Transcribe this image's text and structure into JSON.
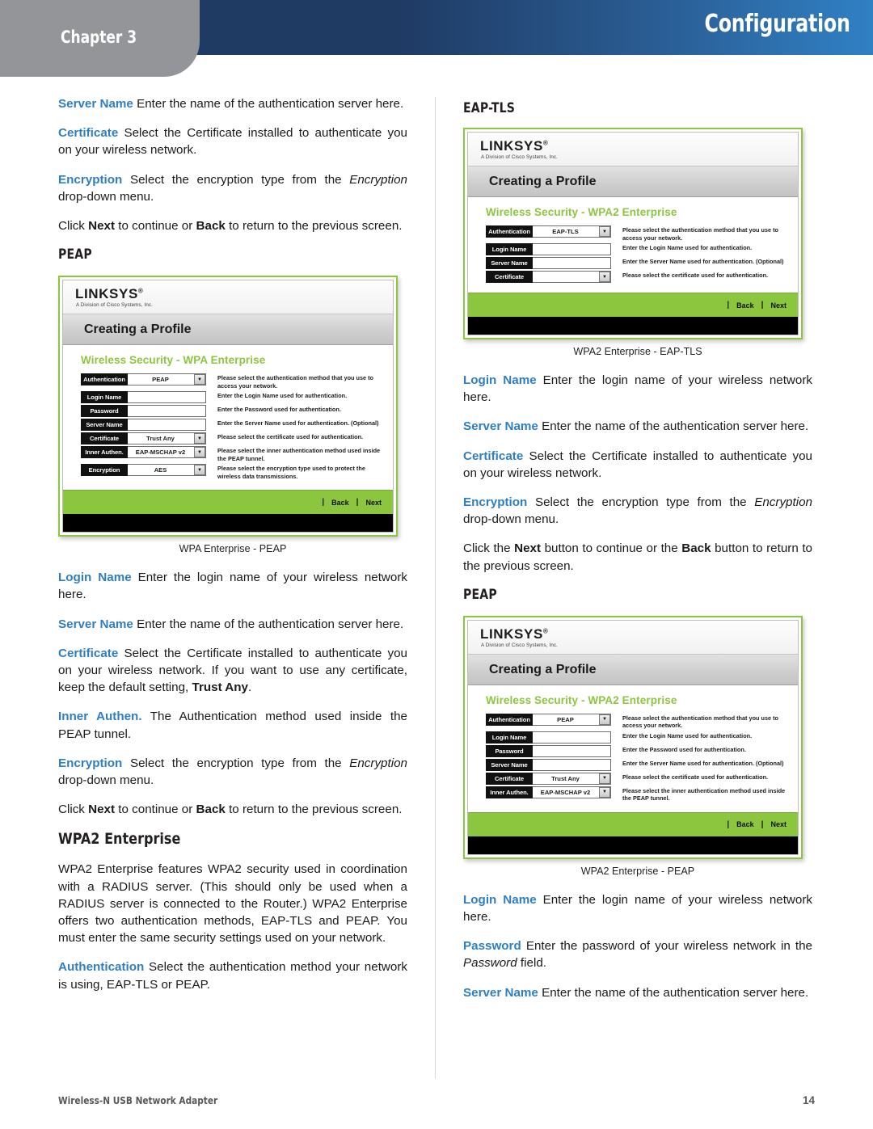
{
  "header": {
    "chapter": "Chapter 3",
    "title": "Configuration"
  },
  "footer": {
    "product": "Wireless-N USB Network Adapter",
    "page_number": "14"
  },
  "colors": {
    "accent_blue": "#2e7ec4",
    "header_navy": "#1f3a63",
    "header_blue": "#3080c4",
    "chapter_gray": "#939598",
    "linksys_green": "#8cc63e"
  },
  "left_column": {
    "para_server_name": {
      "term": "Server Name",
      "text": " Enter the name of the authentication server here."
    },
    "para_certificate": {
      "term": "Certificate",
      "text": "  Select the Certificate installed to authenticate you on your wireless network."
    },
    "para_encryption": {
      "term": "Encryption",
      "text_a": " Select the encryption type from the ",
      "italic": "Encryption",
      "text_b": " drop-down menu."
    },
    "para_click": {
      "a": "Click ",
      "bold1": "Next",
      "b": " to continue or ",
      "bold2": "Back",
      "c": " to return to the previous screen."
    },
    "heading_peap": "PEAP",
    "figure_caption": "WPA Enterprise - PEAP",
    "para_login_name": {
      "term": "Login Name",
      "text": " Enter the login name of your wireless network here."
    },
    "para_server_name2": {
      "term": "Server Name",
      "text": " Enter the name of the authentication server here."
    },
    "para_certificate2": {
      "term": "Certificate",
      "text_a": "  Select the Certificate installed to authenticate you on your wireless network.  If you want to use any certificate, keep the default setting, ",
      "bold": "Trust Any",
      "text_b": "."
    },
    "para_inner_authen": {
      "term": "Inner Authen.",
      "text": " The Authentication method used inside the PEAP tunnel."
    },
    "para_encryption2": {
      "term": "Encryption",
      "text_a": " Select the encryption type from the ",
      "italic": "Encryption",
      "text_b": " drop-down menu."
    },
    "para_click2": {
      "a": "Click ",
      "bold1": "Next",
      "b": " to continue or ",
      "bold2": "Back",
      "c": " to return to the previous screen."
    },
    "heading_wpa2": "WPA2 Enterprise",
    "para_wpa2_intro": "WPA2 Enterprise features WPA2 security used in coordination with a RADIUS server. (This should only be used when a RADIUS server is connected to the Router.) WPA2 Enterprise offers two authentication methods, EAP-TLS and PEAP. You must enter the same security settings used on your network.",
    "para_authentication": {
      "term": "Authentication",
      "text": "  Select the authentication method your network is using, EAP-TLS or PEAP."
    }
  },
  "right_column": {
    "heading_eaptls": "EAP-TLS",
    "figure_caption_eaptls": "WPA2 Enterprise - EAP-TLS",
    "para_login_name": {
      "term": "Login Name",
      "text": " Enter the login name of your wireless network here."
    },
    "para_server_name": {
      "term": "Server Name",
      "text": " Enter the name of the authentication server here."
    },
    "para_certificate": {
      "term": "Certificate",
      "text": "  Select the Certificate installed to authenticate you on your wireless network."
    },
    "para_encryption": {
      "term": "Encryption",
      "text_a": " Select the encryption type from the ",
      "italic": "Encryption",
      "text_b": " drop-down menu."
    },
    "para_click": {
      "a": "Click the ",
      "bold1": "Next",
      "b": " button to continue or the ",
      "bold2": "Back",
      "c": " button to return to the previous screen."
    },
    "heading_peap": "PEAP",
    "figure_caption_peap": "WPA2 Enterprise - PEAP",
    "para_login_name2": {
      "term": "Login Name",
      "text": " Enter the login name of your wireless network here."
    },
    "para_password": {
      "term": "Password",
      "text_a": "  Enter the password of your wireless network in the ",
      "italic": "Password",
      "text_b": " field."
    },
    "para_server_name2": {
      "term": "Server Name",
      "text": " Enter the name of the authentication server here."
    }
  },
  "screenshots": {
    "wpa_peap": {
      "logo": "LINKSYS",
      "logo_reg": "®",
      "logo_sub": "A Division of Cisco Systems, Inc.",
      "window_title": "Creating a Profile",
      "section_heading": "Wireless Security - WPA Enterprise",
      "rows": [
        {
          "label": "Authentication",
          "value": "PEAP",
          "dropdown": true,
          "desc": "Please select the authentication method that you use to access your network."
        },
        {
          "label": "Login Name",
          "value": "",
          "dropdown": false,
          "desc": "Enter the Login Name used for authentication."
        },
        {
          "label": "Password",
          "value": "",
          "dropdown": false,
          "desc": "Enter the Password used for authentication."
        },
        {
          "label": "Server Name",
          "value": "",
          "dropdown": false,
          "desc": "Enter the Server Name used for authentication. (Optional)"
        },
        {
          "label": "Certificate",
          "value": "Trust Any",
          "dropdown": true,
          "desc": "Please select the certificate used for authentication."
        },
        {
          "label": "Inner Authen.",
          "value": "EAP-MSCHAP v2",
          "dropdown": true,
          "desc": "Please select the inner authentication method used inside the PEAP tunnel."
        },
        {
          "label": "Encryption",
          "value": "AES",
          "dropdown": true,
          "desc": "Please select the encryption type used to protect the wireless data transmissions."
        }
      ],
      "back_label": "Back",
      "next_label": "Next"
    },
    "wpa2_eaptls": {
      "logo": "LINKSYS",
      "logo_reg": "®",
      "logo_sub": "A Division of Cisco Systems, Inc.",
      "window_title": "Creating a Profile",
      "section_heading": "Wireless Security - WPA2 Enterprise",
      "rows": [
        {
          "label": "Authentication",
          "value": "EAP-TLS",
          "dropdown": true,
          "desc": "Please select the authentication method that you use to access your network."
        },
        {
          "label": "Login Name",
          "value": "",
          "dropdown": false,
          "desc": "Enter the Login Name used for authentication."
        },
        {
          "label": "Server Name",
          "value": "",
          "dropdown": false,
          "desc": "Enter the Server Name used for authentication. (Optional)"
        },
        {
          "label": "Certificate",
          "value": "",
          "dropdown": true,
          "desc": "Please select the certificate used for authentication."
        }
      ],
      "back_label": "Back",
      "next_label": "Next"
    },
    "wpa2_peap": {
      "logo": "LINKSYS",
      "logo_reg": "®",
      "logo_sub": "A Division of Cisco Systems, Inc.",
      "window_title": "Creating a Profile",
      "section_heading": "Wireless Security - WPA2 Enterprise",
      "rows": [
        {
          "label": "Authentication",
          "value": "PEAP",
          "dropdown": true,
          "desc": "Please select the authentication method that you use to access your network."
        },
        {
          "label": "Login Name",
          "value": "",
          "dropdown": false,
          "desc": "Enter the Login Name used for authentication."
        },
        {
          "label": "Password",
          "value": "",
          "dropdown": false,
          "desc": "Enter the Password used for authentication."
        },
        {
          "label": "Server Name",
          "value": "",
          "dropdown": false,
          "desc": "Enter the Server Name used for authentication. (Optional)"
        },
        {
          "label": "Certificate",
          "value": "Trust Any",
          "dropdown": true,
          "desc": "Please select the certificate used for authentication."
        },
        {
          "label": "Inner Authen.",
          "value": "EAP-MSCHAP v2",
          "dropdown": true,
          "desc": "Please select the inner authentication method used inside the PEAP tunnel."
        }
      ],
      "back_label": "Back",
      "next_label": "Next"
    }
  }
}
